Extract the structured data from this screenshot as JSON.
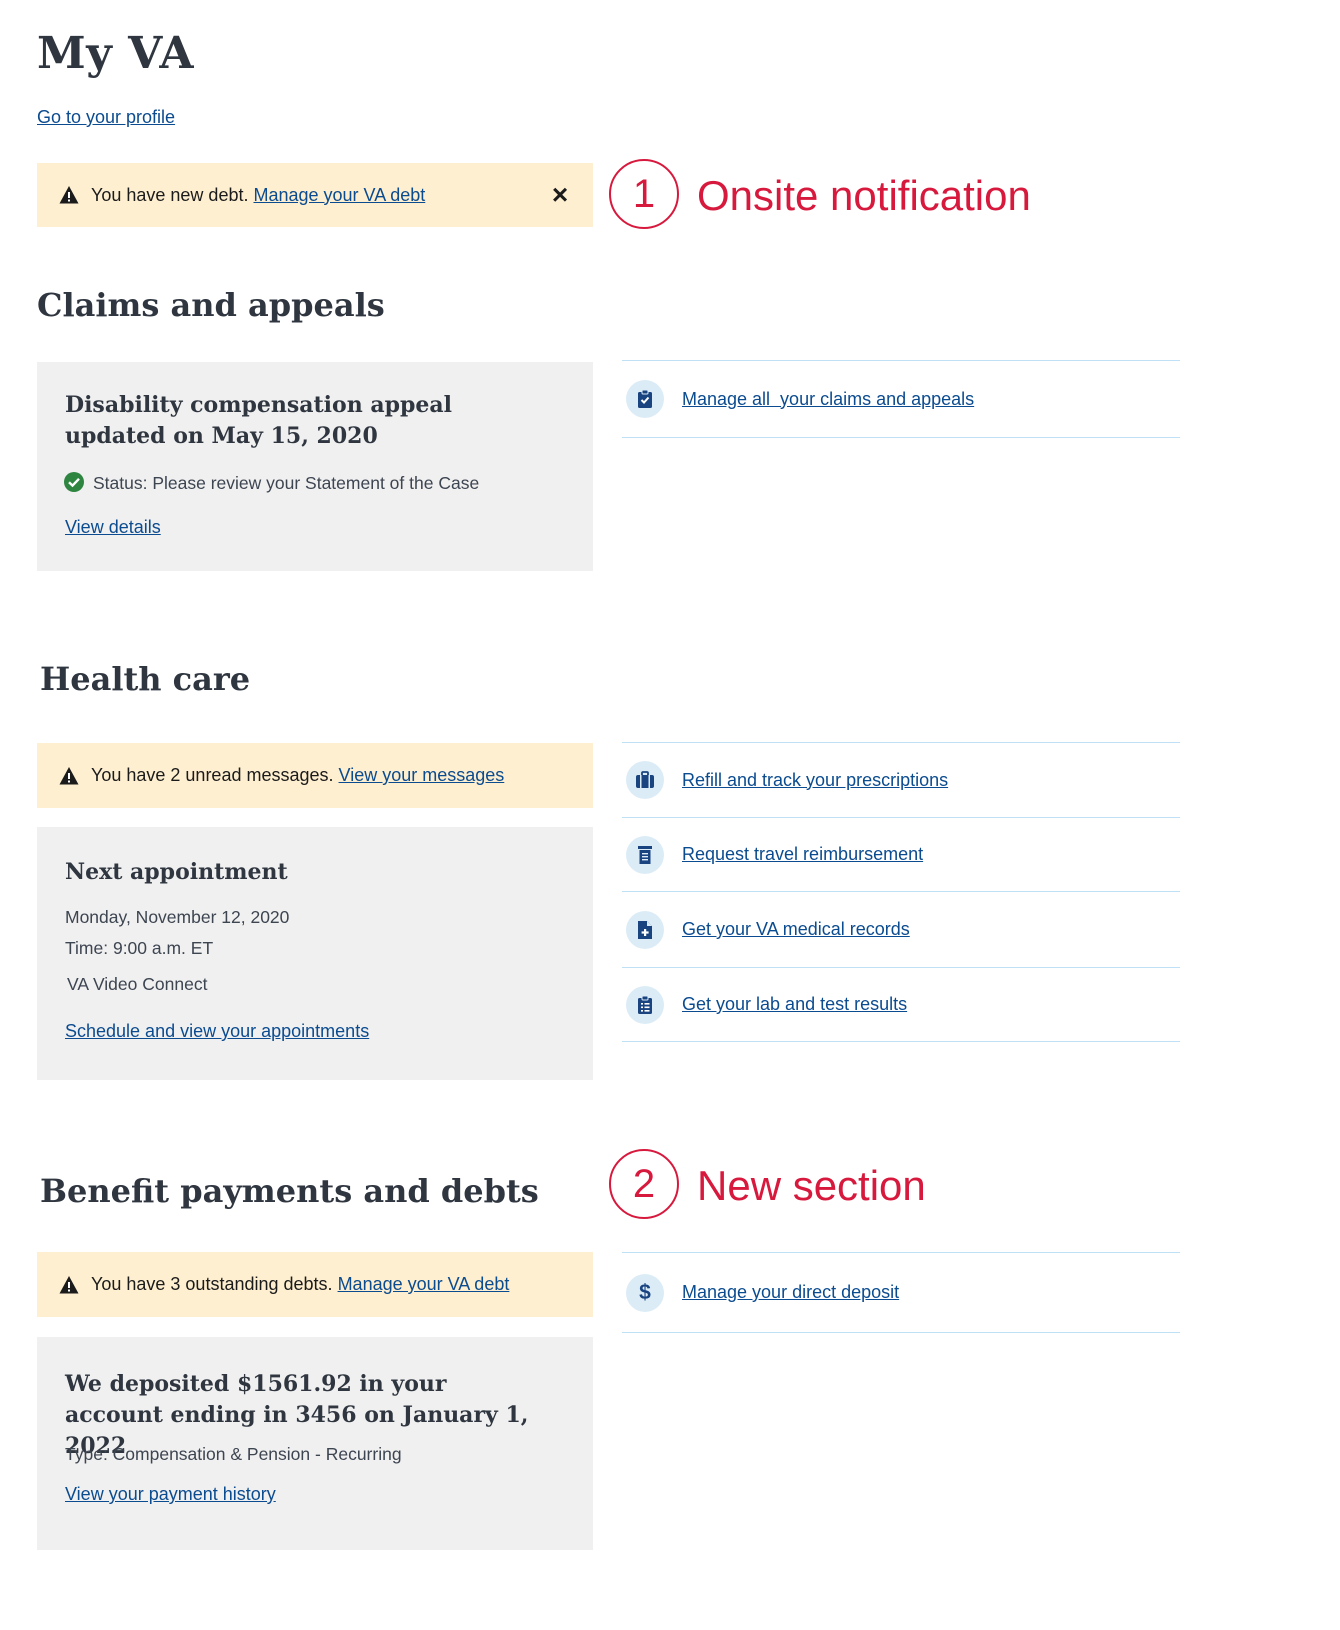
{
  "page": {
    "title": "My VA",
    "profile_link": "Go to your profile"
  },
  "notification": {
    "text": "You have new debt.",
    "link": "Manage your VA debt",
    "close_label": "×"
  },
  "annotations": [
    {
      "number": "1",
      "label": "Onsite notification"
    },
    {
      "number": "2",
      "label": "New section"
    }
  ],
  "claims": {
    "heading": "Claims and appeals",
    "card_title": "Disability compensation appeal updated on May 15, 2020",
    "status": "Status: Please review your Statement of the Case",
    "view_details": "View details",
    "links": [
      {
        "label": "Manage all  your claims and appeals",
        "icon": "clipboard-check-icon"
      }
    ]
  },
  "health": {
    "heading": "Health care",
    "alert_text": "You have 2 unread messages.",
    "alert_link": "View your messages",
    "card_title": "Next appointment",
    "date": "Monday, November 12, 2020",
    "time": "Time: 9:00 a.m. ET",
    "location": "VA Video Connect",
    "schedule_link": "Schedule and view your appointments",
    "links": [
      {
        "label": "Refill and track your prescriptions",
        "icon": "prescription-bag-icon"
      },
      {
        "label": "Request travel reimbursement",
        "icon": "receipt-icon"
      },
      {
        "label": "Get your VA medical records",
        "icon": "medical-file-icon"
      },
      {
        "label": "Get your lab and test results",
        "icon": "clipboard-list-icon"
      }
    ]
  },
  "benefits": {
    "heading": "Benefit payments and debts",
    "alert_text": "You have 3 outstanding debts.",
    "alert_link": "Manage your VA debt",
    "card_title": "We deposited $1561.92 in your account ending in 3456 on January 1, 2022",
    "type": "Type: Compensation & Pension - Recurring",
    "history_link": "View your payment history",
    "links": [
      {
        "label": "Manage your direct deposit",
        "icon": "dollar-icon"
      }
    ]
  },
  "colors": {
    "link": "#0b4b8f",
    "alert_bg": "#feefd0",
    "card_bg": "#f0f0f0",
    "divider": "#bfe0f5",
    "annotation": "#d7193d",
    "success": "#2e8540"
  }
}
